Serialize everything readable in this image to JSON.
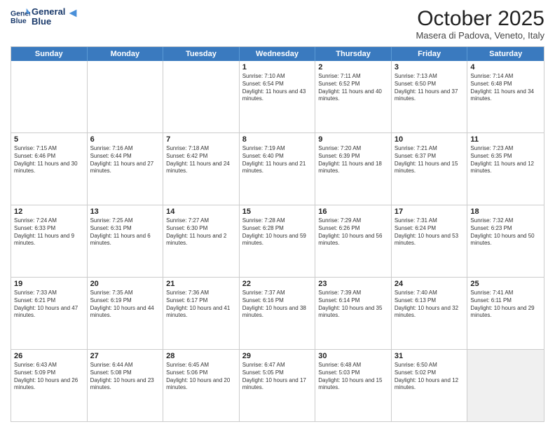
{
  "header": {
    "logo_line1": "General",
    "logo_line2": "Blue",
    "month": "October 2025",
    "location": "Masera di Padova, Veneto, Italy"
  },
  "days_of_week": [
    "Sunday",
    "Monday",
    "Tuesday",
    "Wednesday",
    "Thursday",
    "Friday",
    "Saturday"
  ],
  "weeks": [
    [
      {
        "day": "",
        "sunrise": "",
        "sunset": "",
        "daylight": ""
      },
      {
        "day": "",
        "sunrise": "",
        "sunset": "",
        "daylight": ""
      },
      {
        "day": "",
        "sunrise": "",
        "sunset": "",
        "daylight": ""
      },
      {
        "day": "1",
        "sunrise": "Sunrise: 7:10 AM",
        "sunset": "Sunset: 6:54 PM",
        "daylight": "Daylight: 11 hours and 43 minutes."
      },
      {
        "day": "2",
        "sunrise": "Sunrise: 7:11 AM",
        "sunset": "Sunset: 6:52 PM",
        "daylight": "Daylight: 11 hours and 40 minutes."
      },
      {
        "day": "3",
        "sunrise": "Sunrise: 7:13 AM",
        "sunset": "Sunset: 6:50 PM",
        "daylight": "Daylight: 11 hours and 37 minutes."
      },
      {
        "day": "4",
        "sunrise": "Sunrise: 7:14 AM",
        "sunset": "Sunset: 6:48 PM",
        "daylight": "Daylight: 11 hours and 34 minutes."
      }
    ],
    [
      {
        "day": "5",
        "sunrise": "Sunrise: 7:15 AM",
        "sunset": "Sunset: 6:46 PM",
        "daylight": "Daylight: 11 hours and 30 minutes."
      },
      {
        "day": "6",
        "sunrise": "Sunrise: 7:16 AM",
        "sunset": "Sunset: 6:44 PM",
        "daylight": "Daylight: 11 hours and 27 minutes."
      },
      {
        "day": "7",
        "sunrise": "Sunrise: 7:18 AM",
        "sunset": "Sunset: 6:42 PM",
        "daylight": "Daylight: 11 hours and 24 minutes."
      },
      {
        "day": "8",
        "sunrise": "Sunrise: 7:19 AM",
        "sunset": "Sunset: 6:40 PM",
        "daylight": "Daylight: 11 hours and 21 minutes."
      },
      {
        "day": "9",
        "sunrise": "Sunrise: 7:20 AM",
        "sunset": "Sunset: 6:39 PM",
        "daylight": "Daylight: 11 hours and 18 minutes."
      },
      {
        "day": "10",
        "sunrise": "Sunrise: 7:21 AM",
        "sunset": "Sunset: 6:37 PM",
        "daylight": "Daylight: 11 hours and 15 minutes."
      },
      {
        "day": "11",
        "sunrise": "Sunrise: 7:23 AM",
        "sunset": "Sunset: 6:35 PM",
        "daylight": "Daylight: 11 hours and 12 minutes."
      }
    ],
    [
      {
        "day": "12",
        "sunrise": "Sunrise: 7:24 AM",
        "sunset": "Sunset: 6:33 PM",
        "daylight": "Daylight: 11 hours and 9 minutes."
      },
      {
        "day": "13",
        "sunrise": "Sunrise: 7:25 AM",
        "sunset": "Sunset: 6:31 PM",
        "daylight": "Daylight: 11 hours and 6 minutes."
      },
      {
        "day": "14",
        "sunrise": "Sunrise: 7:27 AM",
        "sunset": "Sunset: 6:30 PM",
        "daylight": "Daylight: 11 hours and 2 minutes."
      },
      {
        "day": "15",
        "sunrise": "Sunrise: 7:28 AM",
        "sunset": "Sunset: 6:28 PM",
        "daylight": "Daylight: 10 hours and 59 minutes."
      },
      {
        "day": "16",
        "sunrise": "Sunrise: 7:29 AM",
        "sunset": "Sunset: 6:26 PM",
        "daylight": "Daylight: 10 hours and 56 minutes."
      },
      {
        "day": "17",
        "sunrise": "Sunrise: 7:31 AM",
        "sunset": "Sunset: 6:24 PM",
        "daylight": "Daylight: 10 hours and 53 minutes."
      },
      {
        "day": "18",
        "sunrise": "Sunrise: 7:32 AM",
        "sunset": "Sunset: 6:23 PM",
        "daylight": "Daylight: 10 hours and 50 minutes."
      }
    ],
    [
      {
        "day": "19",
        "sunrise": "Sunrise: 7:33 AM",
        "sunset": "Sunset: 6:21 PM",
        "daylight": "Daylight: 10 hours and 47 minutes."
      },
      {
        "day": "20",
        "sunrise": "Sunrise: 7:35 AM",
        "sunset": "Sunset: 6:19 PM",
        "daylight": "Daylight: 10 hours and 44 minutes."
      },
      {
        "day": "21",
        "sunrise": "Sunrise: 7:36 AM",
        "sunset": "Sunset: 6:17 PM",
        "daylight": "Daylight: 10 hours and 41 minutes."
      },
      {
        "day": "22",
        "sunrise": "Sunrise: 7:37 AM",
        "sunset": "Sunset: 6:16 PM",
        "daylight": "Daylight: 10 hours and 38 minutes."
      },
      {
        "day": "23",
        "sunrise": "Sunrise: 7:39 AM",
        "sunset": "Sunset: 6:14 PM",
        "daylight": "Daylight: 10 hours and 35 minutes."
      },
      {
        "day": "24",
        "sunrise": "Sunrise: 7:40 AM",
        "sunset": "Sunset: 6:13 PM",
        "daylight": "Daylight: 10 hours and 32 minutes."
      },
      {
        "day": "25",
        "sunrise": "Sunrise: 7:41 AM",
        "sunset": "Sunset: 6:11 PM",
        "daylight": "Daylight: 10 hours and 29 minutes."
      }
    ],
    [
      {
        "day": "26",
        "sunrise": "Sunrise: 6:43 AM",
        "sunset": "Sunset: 5:09 PM",
        "daylight": "Daylight: 10 hours and 26 minutes."
      },
      {
        "day": "27",
        "sunrise": "Sunrise: 6:44 AM",
        "sunset": "Sunset: 5:08 PM",
        "daylight": "Daylight: 10 hours and 23 minutes."
      },
      {
        "day": "28",
        "sunrise": "Sunrise: 6:45 AM",
        "sunset": "Sunset: 5:06 PM",
        "daylight": "Daylight: 10 hours and 20 minutes."
      },
      {
        "day": "29",
        "sunrise": "Sunrise: 6:47 AM",
        "sunset": "Sunset: 5:05 PM",
        "daylight": "Daylight: 10 hours and 17 minutes."
      },
      {
        "day": "30",
        "sunrise": "Sunrise: 6:48 AM",
        "sunset": "Sunset: 5:03 PM",
        "daylight": "Daylight: 10 hours and 15 minutes."
      },
      {
        "day": "31",
        "sunrise": "Sunrise: 6:50 AM",
        "sunset": "Sunset: 5:02 PM",
        "daylight": "Daylight: 10 hours and 12 minutes."
      },
      {
        "day": "",
        "sunrise": "",
        "sunset": "",
        "daylight": ""
      }
    ]
  ]
}
